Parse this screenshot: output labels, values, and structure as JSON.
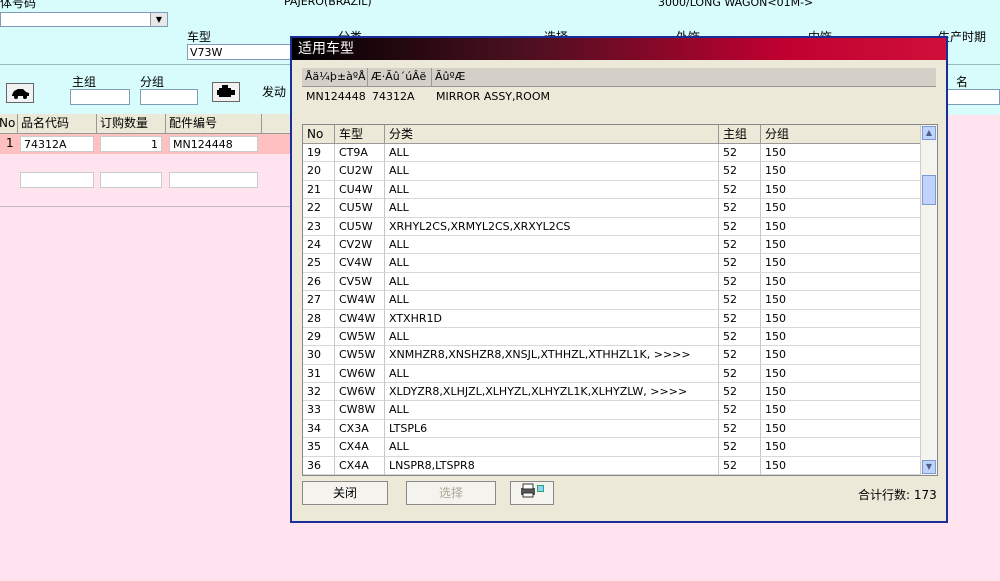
{
  "header": {
    "chassis_label": "车体号码",
    "model_label": "车型",
    "model_value": "V73W",
    "vehicle_name": "PAJERO(BRAZIL)",
    "variant": "3000/LONG WAGON<01M->",
    "category_label": "分类",
    "options_label": "选择",
    "exterior_label": "外饰",
    "interior_label": "内饰",
    "production_label": "生产时期"
  },
  "toolbar": {
    "main_group_label": "主组",
    "sub_group_label": "分组",
    "engine_label": "发动",
    "name_label": "名"
  },
  "grid": {
    "headers": [
      "No",
      "品名代码",
      "订购数量",
      "配件编号"
    ],
    "rows": [
      {
        "no": "1",
        "code": "74312A",
        "qty": "1",
        "part": "MN124448"
      }
    ]
  },
  "dialog": {
    "title": "适用车型",
    "info_headers": [
      "Åä¼þ±àºÅ",
      "Æ·Ãû´úÂë",
      "ÃûºÆ"
    ],
    "info_values": [
      "MN124448",
      "74312A",
      "MIRROR ASSY,ROOM"
    ],
    "list_headers": [
      "No",
      "车型",
      "分类",
      "主组",
      "分组"
    ],
    "rows": [
      {
        "no": "19",
        "model": "CT9A",
        "cat": "ALL",
        "main": "52",
        "sub": "150"
      },
      {
        "no": "20",
        "model": "CU2W",
        "cat": "ALL",
        "main": "52",
        "sub": "150"
      },
      {
        "no": "21",
        "model": "CU4W",
        "cat": "ALL",
        "main": "52",
        "sub": "150"
      },
      {
        "no": "22",
        "model": "CU5W",
        "cat": "ALL",
        "main": "52",
        "sub": "150"
      },
      {
        "no": "23",
        "model": "CU5W",
        "cat": "XRHYL2CS,XRMYL2CS,XRXYL2CS",
        "main": "52",
        "sub": "150"
      },
      {
        "no": "24",
        "model": "CV2W",
        "cat": "ALL",
        "main": "52",
        "sub": "150"
      },
      {
        "no": "25",
        "model": "CV4W",
        "cat": "ALL",
        "main": "52",
        "sub": "150"
      },
      {
        "no": "26",
        "model": "CV5W",
        "cat": "ALL",
        "main": "52",
        "sub": "150"
      },
      {
        "no": "27",
        "model": "CW4W",
        "cat": "ALL",
        "main": "52",
        "sub": "150"
      },
      {
        "no": "28",
        "model": "CW4W",
        "cat": "XTXHR1D",
        "main": "52",
        "sub": "150"
      },
      {
        "no": "29",
        "model": "CW5W",
        "cat": "ALL",
        "main": "52",
        "sub": "150"
      },
      {
        "no": "30",
        "model": "CW5W",
        "cat": "XNMHZR8,XNSHZR8,XNSJL,XTHHZL,XTHHZL1K,  >>>>",
        "main": "52",
        "sub": "150"
      },
      {
        "no": "31",
        "model": "CW6W",
        "cat": "ALL",
        "main": "52",
        "sub": "150"
      },
      {
        "no": "32",
        "model": "CW6W",
        "cat": "XLDYZR8,XLHJZL,XLHYZL,XLHYZL1K,XLHYZLW,  >>>>",
        "main": "52",
        "sub": "150"
      },
      {
        "no": "33",
        "model": "CW8W",
        "cat": "ALL",
        "main": "52",
        "sub": "150"
      },
      {
        "no": "34",
        "model": "CX3A",
        "cat": "LTSPL6",
        "main": "52",
        "sub": "150"
      },
      {
        "no": "35",
        "model": "CX4A",
        "cat": "ALL",
        "main": "52",
        "sub": "150"
      },
      {
        "no": "36",
        "model": "CX4A",
        "cat": "LNSPR8,LTSPR8",
        "main": "52",
        "sub": "150"
      }
    ],
    "close_label": "关闭",
    "select_label": "选择",
    "total_label": "合计行数: 173"
  }
}
